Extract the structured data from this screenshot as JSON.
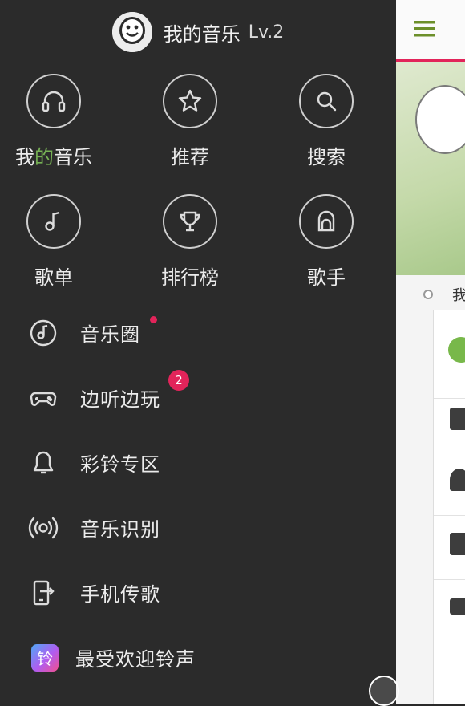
{
  "profile": {
    "title": "我的音乐",
    "level": "Lv.2",
    "avatar_icon": "smiley-face-icon"
  },
  "grid": [
    {
      "label_prefix": "我",
      "label_accent": "的",
      "label_suffix": "音乐",
      "icon": "headphones-icon"
    },
    {
      "label": "推荐",
      "icon": "star-icon"
    },
    {
      "label": "搜索",
      "icon": "search-icon"
    },
    {
      "label": "歌单",
      "icon": "music-note-icon"
    },
    {
      "label": "排行榜",
      "icon": "trophy-icon"
    },
    {
      "label": "歌手",
      "icon": "singer-icon"
    }
  ],
  "menu": [
    {
      "label": "音乐圈",
      "icon": "disc-icon",
      "indicator": "dot"
    },
    {
      "label": "边听边玩",
      "icon": "gamepad-icon",
      "badge": "2"
    },
    {
      "label": "彩铃专区",
      "icon": "bell-icon"
    },
    {
      "label": "音乐识别",
      "icon": "radio-waves-icon"
    },
    {
      "label": "手机传歌",
      "icon": "phone-transfer-icon"
    },
    {
      "label": "最受欢迎铃声",
      "icon": "ringtone-app-icon",
      "icon_text": "铃"
    }
  ],
  "main_peek": {
    "tab_text": "我"
  },
  "colors": {
    "drawer_bg": "#2b2b2b",
    "accent_green": "#77b255",
    "badge_red": "#e2245a",
    "header_underline": "#e2245a",
    "hamburger": "#6c8f2a"
  }
}
